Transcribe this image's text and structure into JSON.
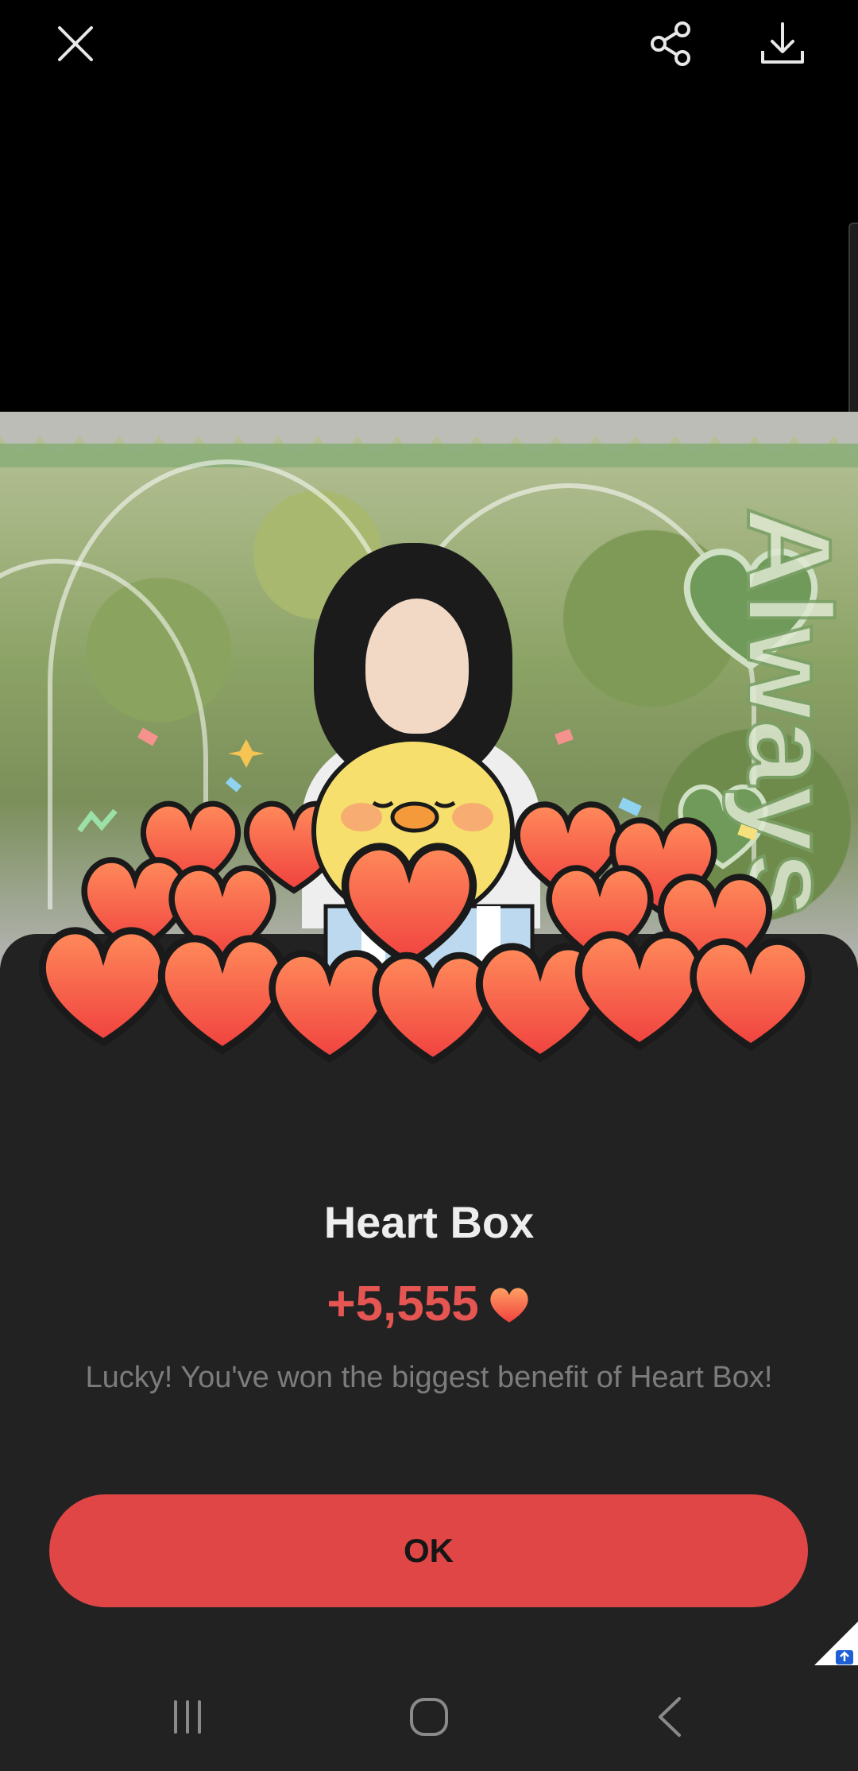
{
  "topbar": {
    "close_icon": "close-icon",
    "share_icon": "share-icon",
    "download_icon": "download-icon"
  },
  "dialog": {
    "title": "Heart Box",
    "amount": "+5,555",
    "amount_icon": "heart-icon",
    "message": "Lucky! You've won the biggest benefit of Heart Box!",
    "ok_label": "OK"
  },
  "navbar": {
    "recents_icon": "recents-icon",
    "home_icon": "home-icon",
    "back_icon": "back-icon"
  },
  "colors": {
    "accent": "#e04646",
    "amount": "#e55552",
    "sheet": "#222222",
    "background": "#000000"
  }
}
